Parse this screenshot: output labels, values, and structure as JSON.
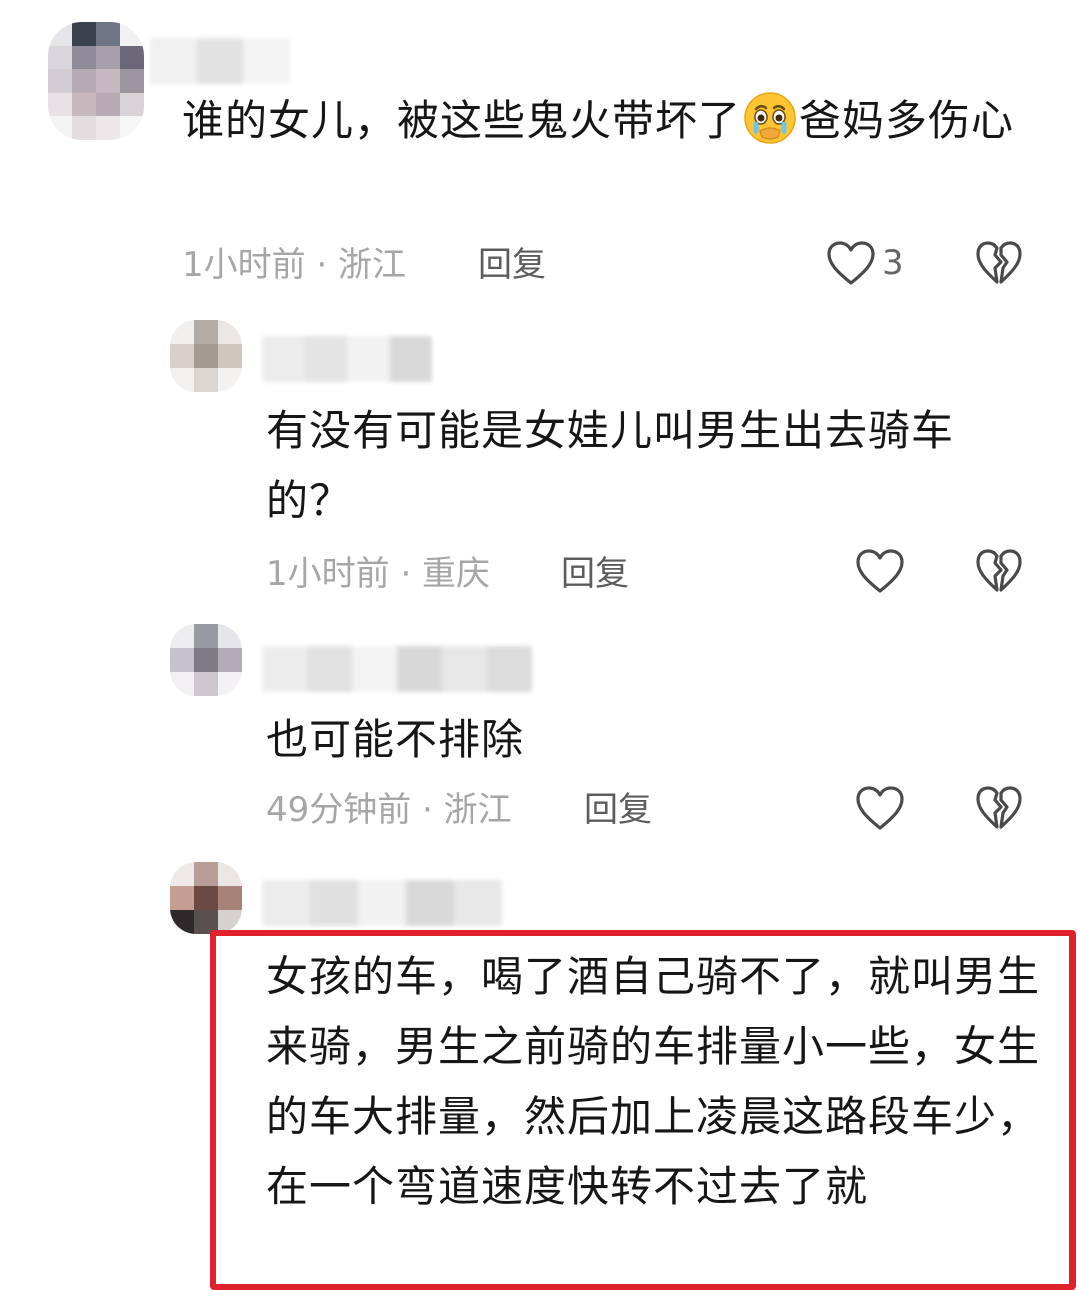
{
  "comments": [
    {
      "text_before": "谁的女儿，被这些鬼火带坏了",
      "emoji": "crying-face",
      "text_after": "爸妈多伤心",
      "meta": "1小时前 · 浙江",
      "reply_label": "回复",
      "like_count": "3"
    },
    {
      "text": "有没有可能是女娃儿叫男生出去骑车的？",
      "meta": "1小时前 · 重庆",
      "reply_label": "回复"
    },
    {
      "text": "也可能不排除",
      "meta": "49分钟前 · 浙江",
      "reply_label": "回复"
    },
    {
      "text": "女孩的车，喝了酒自己骑不了，就叫男生来骑，男生之前骑的车排量小一些，女生的车大排量，然后加上凌晨这路段车少，在一个弯道速度快转不过去了就"
    }
  ],
  "colors": {
    "highlight_border": "#e0212b",
    "meta_text": "#a6a6a6",
    "reply_text": "#5c5c5c"
  },
  "icons": [
    "heart-outline-icon",
    "broken-heart-icon",
    "crying-face-emoji"
  ]
}
